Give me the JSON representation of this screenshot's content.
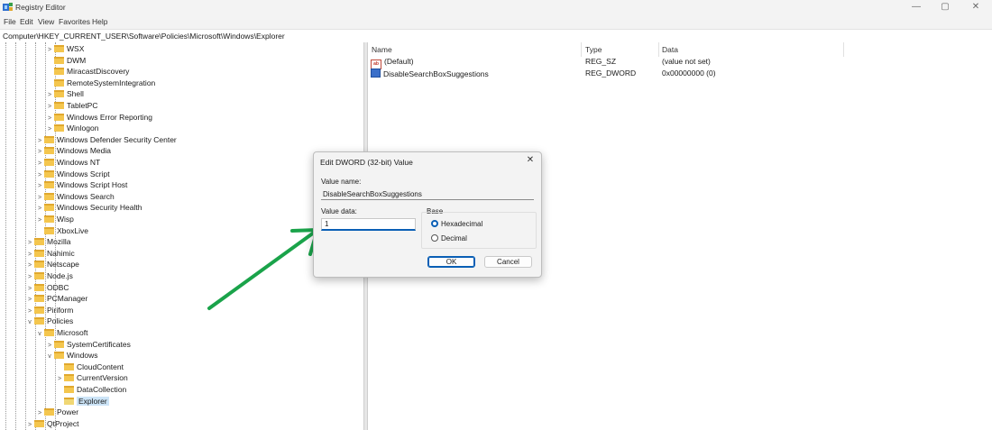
{
  "window": {
    "title": "Registry Editor",
    "controls": {
      "minimize": "—",
      "maximize": "▢",
      "close": "✕"
    }
  },
  "menu": [
    "File",
    "Edit",
    "View",
    "Favorites",
    "Help"
  ],
  "address": "Computer\\HKEY_CURRENT_USER\\Software\\Policies\\Microsoft\\Windows\\Explorer",
  "tree": [
    {
      "label": "WSX",
      "chevron": ">",
      "level": 4,
      "folder": true
    },
    {
      "label": "DWM",
      "chevron": "",
      "level": 4,
      "folder": true
    },
    {
      "label": "MiracastDiscovery",
      "chevron": "",
      "level": 4,
      "folder": true
    },
    {
      "label": "RemoteSystemIntegration",
      "chevron": "",
      "level": 4,
      "folder": true
    },
    {
      "label": "Shell",
      "chevron": ">",
      "level": 4,
      "folder": true
    },
    {
      "label": "TabletPC",
      "chevron": ">",
      "level": 4,
      "folder": true
    },
    {
      "label": "Windows Error Reporting",
      "chevron": ">",
      "level": 4,
      "folder": true
    },
    {
      "label": "Winlogon",
      "chevron": ">",
      "level": 4,
      "folder": true
    },
    {
      "label": "Windows Defender Security Center",
      "chevron": ">",
      "level": 3,
      "folder": true
    },
    {
      "label": "Windows Media",
      "chevron": ">",
      "level": 3,
      "folder": true
    },
    {
      "label": "Windows NT",
      "chevron": ">",
      "level": 3,
      "folder": true
    },
    {
      "label": "Windows Script",
      "chevron": ">",
      "level": 3,
      "folder": true
    },
    {
      "label": "Windows Script Host",
      "chevron": ">",
      "level": 3,
      "folder": true
    },
    {
      "label": "Windows Search",
      "chevron": ">",
      "level": 3,
      "folder": true
    },
    {
      "label": "Windows Security Health",
      "chevron": ">",
      "level": 3,
      "folder": true
    },
    {
      "label": "Wisp",
      "chevron": ">",
      "level": 3,
      "folder": true
    },
    {
      "label": "XboxLive",
      "chevron": "",
      "level": 3,
      "folder": true
    },
    {
      "label": "Mozilla",
      "chevron": ">",
      "level": 2,
      "folder": true
    },
    {
      "label": "Nahimic",
      "chevron": ">",
      "level": 2,
      "folder": true
    },
    {
      "label": "Netscape",
      "chevron": ">",
      "level": 2,
      "folder": true
    },
    {
      "label": "Node.js",
      "chevron": ">",
      "level": 2,
      "folder": true
    },
    {
      "label": "ODBC",
      "chevron": ">",
      "level": 2,
      "folder": true
    },
    {
      "label": "PCManager",
      "chevron": ">",
      "level": 2,
      "folder": true
    },
    {
      "label": "Piriform",
      "chevron": ">",
      "level": 2,
      "folder": true
    },
    {
      "label": "Policies",
      "chevron": "v",
      "level": 2,
      "folder": true
    },
    {
      "label": "Microsoft",
      "chevron": "v",
      "level": 3,
      "folder": true
    },
    {
      "label": "SystemCertificates",
      "chevron": ">",
      "level": 4,
      "folder": true
    },
    {
      "label": "Windows",
      "chevron": "v",
      "level": 4,
      "folder": true
    },
    {
      "label": "CloudContent",
      "chevron": "",
      "level": 5,
      "folder": true
    },
    {
      "label": "CurrentVersion",
      "chevron": ">",
      "level": 5,
      "folder": true
    },
    {
      "label": "DataCollection",
      "chevron": "",
      "level": 5,
      "folder": true
    },
    {
      "label": "Explorer",
      "chevron": "",
      "level": 5,
      "folder": true,
      "selected": true
    },
    {
      "label": "Power",
      "chevron": ">",
      "level": 3,
      "folder": true
    },
    {
      "label": "QtProject",
      "chevron": ">",
      "level": 2,
      "folder": true
    }
  ],
  "values_pane": {
    "columns": {
      "name": "Name",
      "type": "Type",
      "data": "Data"
    },
    "rows": [
      {
        "icon": "string-value-icon",
        "icon_text": "ab",
        "name": "(Default)",
        "type": "REG_SZ",
        "data": "(value not set)"
      },
      {
        "icon": "dword-value-icon",
        "name": "DisableSearchBoxSuggestions",
        "type": "REG_DWORD",
        "data": "0x00000000 (0)"
      }
    ]
  },
  "dialog": {
    "title": "Edit DWORD (32-bit) Value",
    "close": "✕",
    "value_name_label": "Value name:",
    "value_name": "DisableSearchBoxSuggestions",
    "value_data_label": "Value data:",
    "value_data": "1",
    "base_label": "Base",
    "base_options": [
      {
        "label": "Hexadecimal",
        "checked": true
      },
      {
        "label": "Decimal",
        "checked": false
      }
    ],
    "ok_label": "OK",
    "cancel_label": "Cancel"
  },
  "colors": {
    "accent": "#0a5fb5",
    "arrow": "#1aa34a",
    "folder": "#f4c64e",
    "selection": "#cce4f7"
  }
}
